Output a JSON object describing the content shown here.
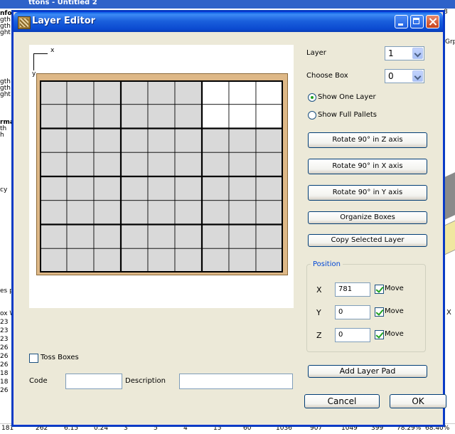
{
  "background": {
    "title": "ttons - Untitled 2",
    "left_labels": [
      {
        "text": "nfor",
        "bold": true
      },
      {
        "text": "gth"
      },
      {
        "text": "gth"
      },
      {
        "text": "ght"
      },
      {
        "text": "gth"
      },
      {
        "text": "gth"
      },
      {
        "text": "ght"
      },
      {
        "text": "rma",
        "bold": true
      },
      {
        "text": "th"
      },
      {
        "text": "h"
      },
      {
        "text": "cy"
      },
      {
        "text": "es p"
      },
      {
        "text": "ox W"
      },
      {
        "text": "23"
      },
      {
        "text": "23"
      },
      {
        "text": "23"
      },
      {
        "text": "26"
      },
      {
        "text": "26"
      },
      {
        "text": "26"
      },
      {
        "text": "18"
      },
      {
        "text": "18"
      },
      {
        "text": "26"
      }
    ],
    "right_labels": [
      "8",
      "Grp",
      "X"
    ],
    "bottom_row": [
      "181",
      "262",
      "6.15",
      "0.24",
      "3",
      "5",
      "4",
      "15",
      "60",
      "1036",
      "907",
      "1049",
      "399",
      "78.29%",
      "68.40%"
    ]
  },
  "dialog": {
    "title": "Layer Editor",
    "layer_label": "Layer",
    "layer_value": "1",
    "choose_box_label": "Choose Box",
    "choose_box_value": "0",
    "show_one_layer": "Show One Layer",
    "show_full_pallets": "Show Full Pallets",
    "rotate_z": "Rotate 90° in Z axis",
    "rotate_x": "Rotate 90° in X axis",
    "rotate_y": "Rotate 90° in Y axis",
    "organize": "Organize Boxes",
    "copy_layer": "Copy Selected Layer",
    "position_title": "Position",
    "x_label": "X",
    "x_value": "781",
    "y_label": "Y",
    "y_value": "0",
    "z_label": "Z",
    "z_value": "0",
    "move_label": "Move",
    "add_layer_pad": "Add Layer Pad",
    "toss_boxes": "Toss Boxes",
    "code_label": "Code",
    "description_label": "Description",
    "cancel": "Cancel",
    "ok": "OK",
    "axis_x": "x",
    "axis_y": "y"
  },
  "colors": {
    "pallet": "#deb887",
    "box": "#d9d9d9",
    "selected_box": "#ffffff",
    "title_blue": "#0b4ad0"
  }
}
